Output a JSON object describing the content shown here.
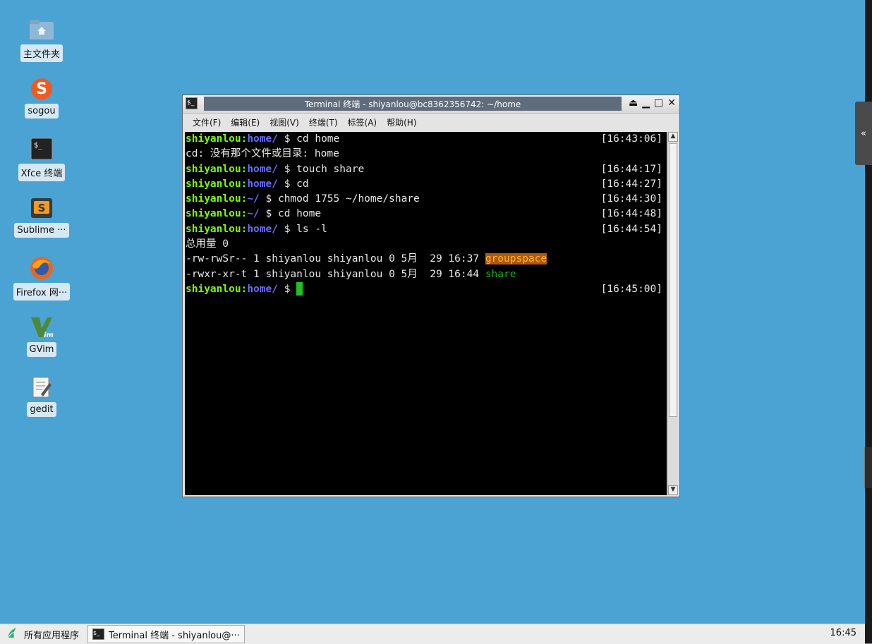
{
  "desktop": {
    "icons": [
      {
        "label": "主文件夹",
        "icon": "home-folder-icon"
      },
      {
        "label": "sogou",
        "icon": "sogou-icon"
      },
      {
        "label": "Xfce 终端",
        "icon": "terminal-icon"
      },
      {
        "label": "Sublime ···",
        "icon": "sublime-icon"
      },
      {
        "label": "Firefox 网···",
        "icon": "firefox-icon"
      },
      {
        "label": "GVim",
        "icon": "gvim-icon"
      },
      {
        "label": "gedit",
        "icon": "gedit-icon"
      }
    ]
  },
  "window": {
    "title": "Terminal 终端 - shiyanlou@bc8362356742: ~/home",
    "menu": [
      "文件(F)",
      "编辑(E)",
      "视图(V)",
      "终端(T)",
      "标签(A)",
      "帮助(H)"
    ]
  },
  "terminal": {
    "lines": [
      {
        "user": "shiyanlou",
        "path": "home/",
        "cmd": " $ cd home",
        "time": "[16:43:06]"
      },
      {
        "text": "cd: 没有那个文件或目录: home"
      },
      {
        "user": "shiyanlou",
        "path": "home/",
        "cmd": " $ touch share",
        "time": "[16:44:17]"
      },
      {
        "user": "shiyanlou",
        "path": "home/",
        "cmd": " $ cd",
        "time": "[16:44:27]"
      },
      {
        "user": "shiyanlou",
        "path": "~/",
        "cmd": " $ chmod 1755 ~/home/share",
        "time": "[16:44:30]"
      },
      {
        "user": "shiyanlou",
        "path": "~/",
        "cmd": " $ cd home",
        "time": "[16:44:48]"
      },
      {
        "user": "shiyanlou",
        "path": "home/",
        "cmd": " $ ls -l",
        "time": "[16:44:54]"
      },
      {
        "text": "总用量 0"
      },
      {
        "text": "-rw-rwSr-- 1 shiyanlou shiyanlou 0 5月  29 16:37 ",
        "file": "groupspace",
        "file_style": "setgid"
      },
      {
        "text": "-rwxr-xr-t 1 shiyanlou shiyanlou 0 5月  29 16:44 ",
        "file": "share",
        "file_style": "exec"
      },
      {
        "user": "shiyanlou",
        "path": "home/",
        "cmd": " $ ",
        "time": "[16:45:00]",
        "cursor": true
      }
    ]
  },
  "taskbar": {
    "start_label": "所有应用程序",
    "task_label": "Terminal 终端 - shiyanlou@···",
    "clock": "16:45"
  },
  "side_tab": "«"
}
